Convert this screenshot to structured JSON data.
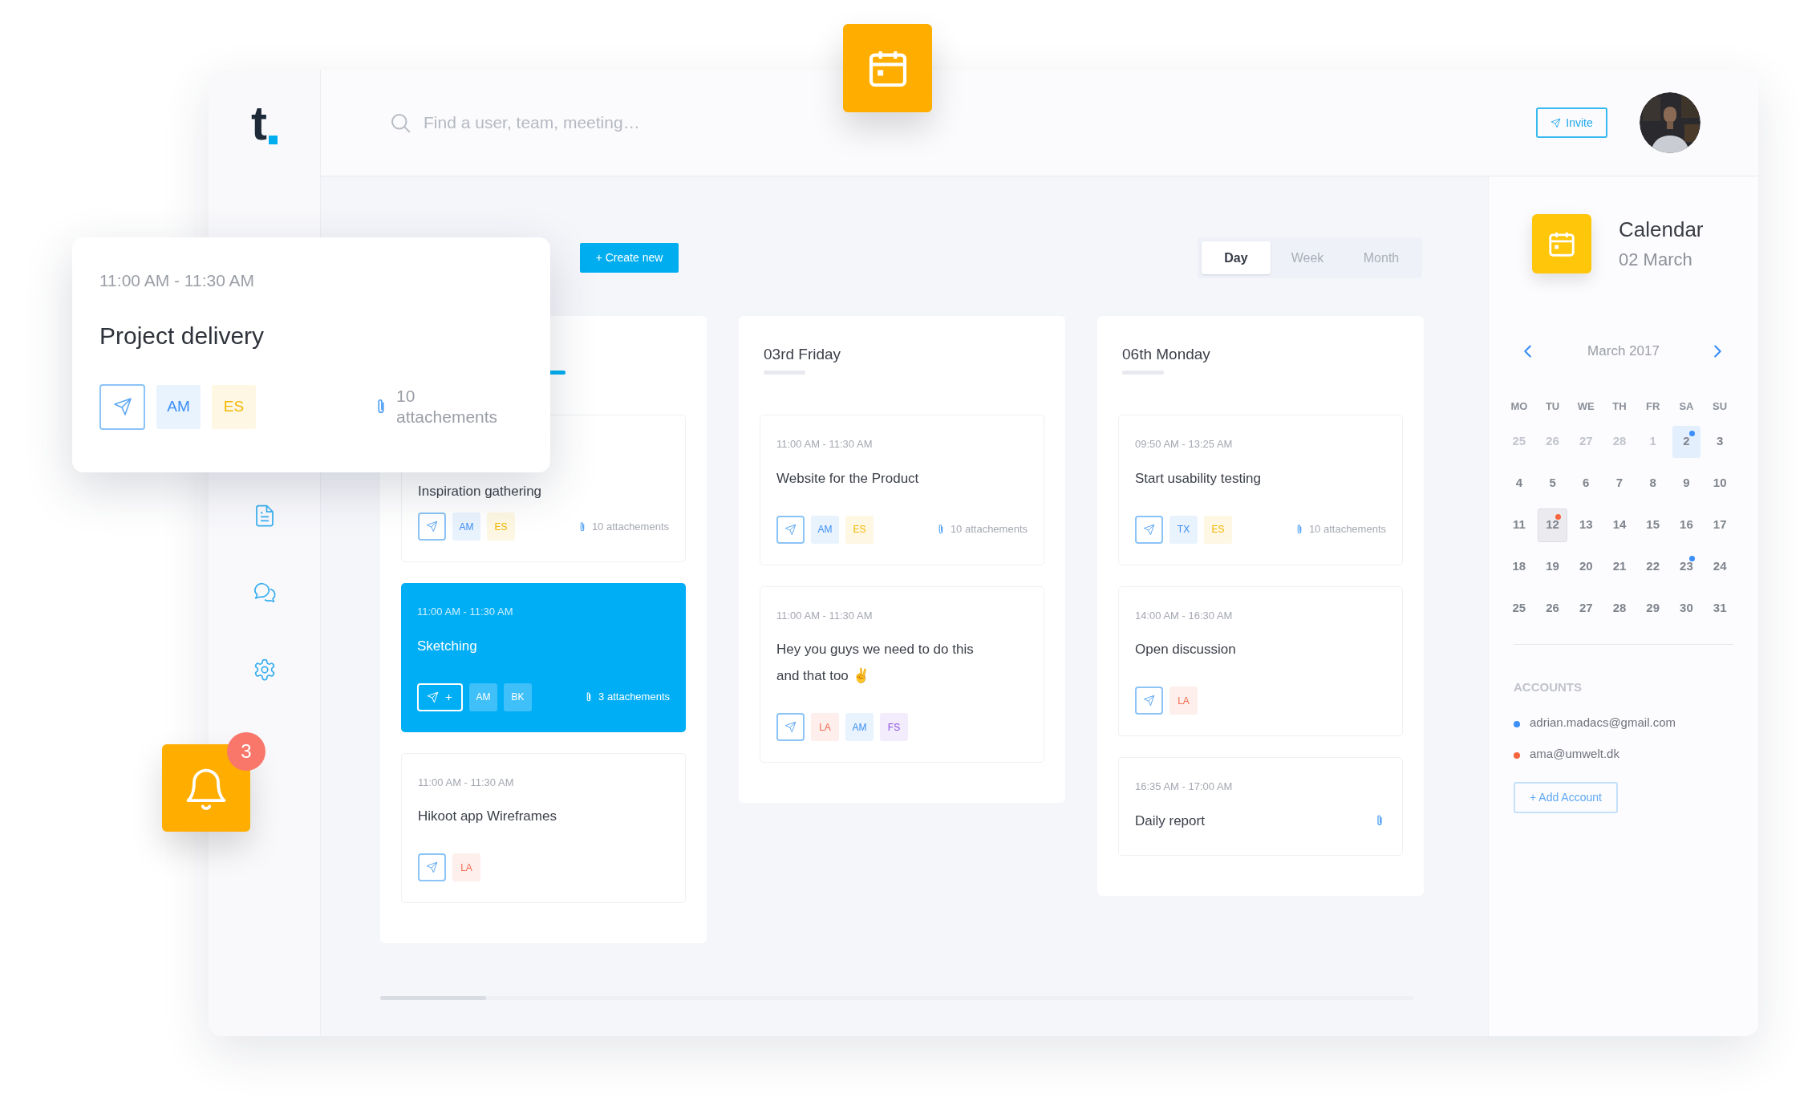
{
  "app": {
    "logo": "t"
  },
  "search": {
    "placeholder": "Find a user, team, meeting…"
  },
  "invite_button": "Invite",
  "create_button": "+ Create new",
  "view_tabs": [
    {
      "label": "Day",
      "selected": true
    },
    {
      "label": "Week",
      "selected": false
    },
    {
      "label": "Month",
      "selected": false
    }
  ],
  "columns": [
    {
      "selected": true,
      "events": [
        {
          "title": "Inspiration gathering",
          "selected": false,
          "share_button": {
            "kind": "send"
          },
          "has_clip": true,
          "attachments": "10 attachements",
          "tags": [
            {
              "label": "AM",
              "color": "#3a8ef6"
            },
            {
              "label": "ES",
              "color": "#f5b700"
            }
          ]
        },
        {
          "time": "11:00 AM - 11:30 AM",
          "title": "Sketching",
          "selected": true,
          "share_button": {
            "kind": "plus"
          },
          "has_clip": true,
          "attachments": "3 attachements",
          "tags": [
            {
              "label": "AM",
              "color": "#3fc0f8"
            },
            {
              "label": "BK",
              "color": "#3fc0f8"
            }
          ]
        },
        {
          "time": "11:00 AM - 11:30 AM",
          "title": "Hikoot app Wireframes",
          "selected": false,
          "share_button": {
            "kind": "send"
          },
          "has_clip": false,
          "tags": [
            {
              "label": "LA",
              "color": "#f56a4f"
            }
          ]
        }
      ]
    },
    {
      "title": "03rd Friday",
      "selected": false,
      "events": [
        {
          "time": "11:00 AM - 11:30 AM",
          "title": "Website for the Product",
          "selected": false,
          "share_button": {
            "kind": "send"
          },
          "has_clip": true,
          "attachments": "10 attachements",
          "tags": [
            {
              "label": "AM",
              "color": "#3a8ef6"
            },
            {
              "label": "ES",
              "color": "#f5b700"
            }
          ]
        },
        {
          "time": "11:00 AM - 11:30 AM",
          "title": "Hey you guys we need to do this and that too ✌",
          "selected": false,
          "share_button": {
            "kind": "send"
          },
          "has_clip": false,
          "tags": [
            {
              "label": "LA",
              "color": "#f56a4f"
            },
            {
              "label": "AM",
              "color": "#3a8ef6"
            },
            {
              "label": "FS",
              "color": "#8a4fe0"
            }
          ]
        }
      ]
    },
    {
      "title": "06th Monday",
      "selected": false,
      "events": [
        {
          "time": "09:50 AM - 13:25 AM",
          "title": "Start usability testing",
          "selected": false,
          "share_button": {
            "kind": "send"
          },
          "has_clip": true,
          "attachments": "10 attachements",
          "tags": [
            {
              "label": "TX",
              "color": "#3a8ef6"
            },
            {
              "label": "ES",
              "color": "#f5b700"
            }
          ]
        },
        {
          "time": "14:00 AM - 16:30 AM",
          "title": "Open discussion",
          "selected": false,
          "share_button": {
            "kind": "send"
          },
          "has_clip": false,
          "tags": [
            {
              "label": "LA",
              "color": "#f56a4f"
            }
          ]
        },
        {
          "time": "16:35 AM - 17:00 AM",
          "title": "Daily report",
          "selected": false,
          "has_clip": true
        }
      ]
    }
  ],
  "calendar": {
    "title": "Calendar",
    "date": "02 March",
    "month": "March 2017",
    "weekdays": [
      "MO",
      "TU",
      "WE",
      "TH",
      "FR",
      "SA",
      "SU"
    ],
    "days": [
      {
        "label": "25",
        "muted": true,
        "selected": false,
        "today": false
      },
      {
        "label": "26",
        "muted": true,
        "selected": false,
        "today": false
      },
      {
        "label": "27",
        "muted": true,
        "selected": false,
        "today": false
      },
      {
        "label": "28",
        "muted": true,
        "selected": false,
        "today": false
      },
      {
        "label": "1",
        "muted": true,
        "selected": false,
        "today": false
      },
      {
        "label": "2",
        "muted": false,
        "selected": true,
        "today": false,
        "color": "#3b8ff6"
      },
      {
        "label": "3",
        "muted": false,
        "selected": false,
        "today": false
      },
      {
        "label": "4",
        "muted": false,
        "selected": false,
        "today": false
      },
      {
        "label": "5",
        "muted": false,
        "selected": false,
        "today": false
      },
      {
        "label": "6",
        "muted": false,
        "selected": false,
        "today": false
      },
      {
        "label": "7",
        "muted": false,
        "selected": false,
        "today": false
      },
      {
        "label": "8",
        "muted": false,
        "selected": false,
        "today": false
      },
      {
        "label": "9",
        "muted": false,
        "selected": false,
        "today": false
      },
      {
        "label": "10",
        "muted": false,
        "selected": false,
        "today": false
      },
      {
        "label": "11",
        "muted": false,
        "selected": false,
        "today": false
      },
      {
        "label": "12",
        "muted": false,
        "selected": false,
        "today": true,
        "color": "#f5663f"
      },
      {
        "label": "13",
        "muted": false,
        "selected": false,
        "today": false
      },
      {
        "label": "14",
        "muted": false,
        "selected": false,
        "today": false
      },
      {
        "label": "15",
        "muted": false,
        "selected": false,
        "today": false
      },
      {
        "label": "16",
        "muted": false,
        "selected": false,
        "today": false
      },
      {
        "label": "17",
        "muted": false,
        "selected": false,
        "today": false
      },
      {
        "label": "18",
        "muted": false,
        "selected": false,
        "today": false
      },
      {
        "label": "19",
        "muted": false,
        "selected": false,
        "today": false
      },
      {
        "label": "20",
        "muted": false,
        "selected": false,
        "today": false
      },
      {
        "label": "21",
        "muted": false,
        "selected": false,
        "today": false
      },
      {
        "label": "22",
        "muted": false,
        "selected": false,
        "today": false
      },
      {
        "label": "23",
        "muted": false,
        "selected": false,
        "today": false,
        "color": "#3b8ff6"
      },
      {
        "label": "24",
        "muted": false,
        "selected": false,
        "today": false
      },
      {
        "label": "25",
        "muted": false,
        "selected": false,
        "today": false
      },
      {
        "label": "26",
        "muted": false,
        "selected": false,
        "today": false
      },
      {
        "label": "27",
        "muted": false,
        "selected": false,
        "today": false
      },
      {
        "label": "28",
        "muted": false,
        "selected": false,
        "today": false
      },
      {
        "label": "29",
        "muted": false,
        "selected": false,
        "today": false
      },
      {
        "label": "30",
        "muted": false,
        "selected": false,
        "today": false
      },
      {
        "label": "31",
        "muted": false,
        "selected": false,
        "today": false
      }
    ]
  },
  "accounts": {
    "heading": "ACCOUNTS",
    "items": [
      {
        "email": "adrian.madacs@gmail.com",
        "color": "#3b8ff6"
      },
      {
        "email": "ama@umwelt.dk",
        "color": "#f5663f"
      }
    ],
    "add_button": "+ Add Account"
  },
  "popup_card": {
    "time": "11:00 AM - 11:30 AM",
    "title": "Project delivery",
    "share_button": {
      "kind": "send"
    },
    "tags": [
      {
        "label": "AM",
        "color": "#3a8ef6"
      },
      {
        "label": "ES",
        "color": "#f5b700"
      }
    ],
    "attachments": "10 attachements"
  },
  "notifications": {
    "count": "3"
  }
}
